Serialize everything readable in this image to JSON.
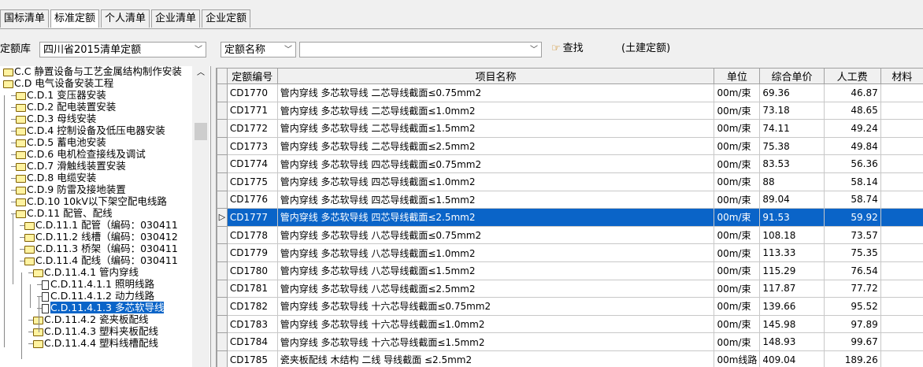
{
  "tabs": [
    {
      "label": "国标清单",
      "active": false
    },
    {
      "label": "标准定额",
      "active": true
    },
    {
      "label": "个人清单",
      "active": false
    },
    {
      "label": "企业清单",
      "active": false
    },
    {
      "label": "企业定额",
      "active": false
    }
  ],
  "filter": {
    "library_label": "定额库",
    "library_value": "四川省2015清单定额",
    "field_value": "定额名称",
    "search_value": "",
    "find_label": "查找",
    "hint": "(土建定额)"
  },
  "tree": [
    {
      "label": "C.C 静置设备与工艺金属结构制作安装",
      "type": "folder"
    },
    {
      "label": "C.D 电气设备安装工程",
      "type": "folder-open"
    },
    {
      "label": "C.D.1 变压器安装",
      "type": "folder"
    },
    {
      "label": "C.D.2 配电装置安装",
      "type": "folder"
    },
    {
      "label": "C.D.3 母线安装",
      "type": "folder"
    },
    {
      "label": "C.D.4 控制设备及低压电器安装",
      "type": "folder"
    },
    {
      "label": "C.D.5 蓄电池安装",
      "type": "folder"
    },
    {
      "label": "C.D.6 电机检查接线及调试",
      "type": "folder"
    },
    {
      "label": "C.D.7 滑触线装置安装",
      "type": "folder"
    },
    {
      "label": "C.D.8 电缆安装",
      "type": "folder"
    },
    {
      "label": "C.D.9 防雷及接地装置",
      "type": "folder"
    },
    {
      "label": "C.D.10 10kV以下架空配电线路",
      "type": "folder"
    },
    {
      "label": "C.D.11 配管、配线",
      "type": "folder-open"
    },
    {
      "label": "C.D.11.1 配管（编码：030411",
      "type": "folder"
    },
    {
      "label": "C.D.11.2 线槽（编码：030412",
      "type": "folder"
    },
    {
      "label": "C.D.11.3 桥架（编码：030411",
      "type": "folder"
    },
    {
      "label": "C.D.11.4 配线（编码：030411",
      "type": "folder-open"
    },
    {
      "label": "C.D.11.4.1 管内穿线",
      "type": "folder-open"
    },
    {
      "label": "C.D.11.4.1.1 照明线路",
      "type": "doc"
    },
    {
      "label": "C.D.11.4.1.2 动力线路",
      "type": "doc"
    },
    {
      "label": "C.D.11.4.1.3 多芯软导线",
      "type": "doc",
      "selected": true
    },
    {
      "label": "C.D.11.4.2 瓷夹板配线",
      "type": "folder"
    },
    {
      "label": "C.D.11.4.3 塑料夹板配线",
      "type": "folder"
    },
    {
      "label": "C.D.11.4.4 塑料线槽配线",
      "type": "folder"
    }
  ],
  "grid": {
    "headers": [
      "定额编号",
      "项目名称",
      "单位",
      "综合单价",
      "人工费",
      "材料"
    ],
    "rows": [
      {
        "code": "CD1770",
        "name": "管内穿线 多芯软导线 二芯导线截面≤0.75mm2",
        "unit": "00m/束",
        "price": "69.36",
        "labor": "46.87"
      },
      {
        "code": "CD1771",
        "name": "管内穿线 多芯软导线 二芯导线截面≤1.0mm2",
        "unit": "00m/束",
        "price": "73.18",
        "labor": "48.65"
      },
      {
        "code": "CD1772",
        "name": "管内穿线 多芯软导线 二芯导线截面≤1.5mm2",
        "unit": "00m/束",
        "price": "74.11",
        "labor": "49.24"
      },
      {
        "code": "CD1773",
        "name": "管内穿线 多芯软导线 二芯导线截面≤2.5mm2",
        "unit": "00m/束",
        "price": "75.38",
        "labor": "49.84"
      },
      {
        "code": "CD1774",
        "name": "管内穿线 多芯软导线 四芯导线截面≤0.75mm2",
        "unit": "00m/束",
        "price": "83.53",
        "labor": "56.36"
      },
      {
        "code": "CD1775",
        "name": "管内穿线 多芯软导线 四芯导线截面≤1.0mm2",
        "unit": "00m/束",
        "price": "88",
        "labor": "58.14"
      },
      {
        "code": "CD1776",
        "name": "管内穿线 多芯软导线 四芯导线截面≤1.5mm2",
        "unit": "00m/束",
        "price": "89.04",
        "labor": "58.74"
      },
      {
        "code": "CD1777",
        "name": "管内穿线 多芯软导线 四芯导线截面≤2.5mm2",
        "unit": "00m/束",
        "price": "91.53",
        "labor": "59.92",
        "selected": true
      },
      {
        "code": "CD1778",
        "name": "管内穿线 多芯软导线 八芯导线截面≤0.75mm2",
        "unit": "00m/束",
        "price": "108.18",
        "labor": "73.57"
      },
      {
        "code": "CD1779",
        "name": "管内穿线 多芯软导线 八芯导线截面≤1.0mm2",
        "unit": "00m/束",
        "price": "113.33",
        "labor": "75.35"
      },
      {
        "code": "CD1780",
        "name": "管内穿线 多芯软导线 八芯导线截面≤1.5mm2",
        "unit": "00m/束",
        "price": "115.29",
        "labor": "76.54"
      },
      {
        "code": "CD1781",
        "name": "管内穿线 多芯软导线 八芯导线截面≤2.5mm2",
        "unit": "00m/束",
        "price": "117.87",
        "labor": "77.72"
      },
      {
        "code": "CD1782",
        "name": "管内穿线 多芯软导线 十六芯导线截面≤0.75mm2",
        "unit": "00m/束",
        "price": "139.66",
        "labor": "95.52"
      },
      {
        "code": "CD1783",
        "name": "管内穿线 多芯软导线 十六芯导线截面≤1.0mm2",
        "unit": "00m/束",
        "price": "145.98",
        "labor": "97.89"
      },
      {
        "code": "CD1784",
        "name": "管内穿线 多芯软导线 十六芯导线截面≤1.5mm2",
        "unit": "00m/束",
        "price": "148.93",
        "labor": "99.67"
      },
      {
        "code": "CD1785",
        "name": "瓷夹板配线 木结构 二线 导线截面 ≤2.5mm2",
        "unit": "00m线路",
        "price": "409.04",
        "labor": "189.26"
      }
    ]
  },
  "colors": {
    "selection": "#0a64c8",
    "folder": "#fff3a0"
  },
  "icons": [
    "folder-icon",
    "document-icon",
    "find-icon",
    "chevron-down-icon",
    "row-pointer-icon"
  ]
}
